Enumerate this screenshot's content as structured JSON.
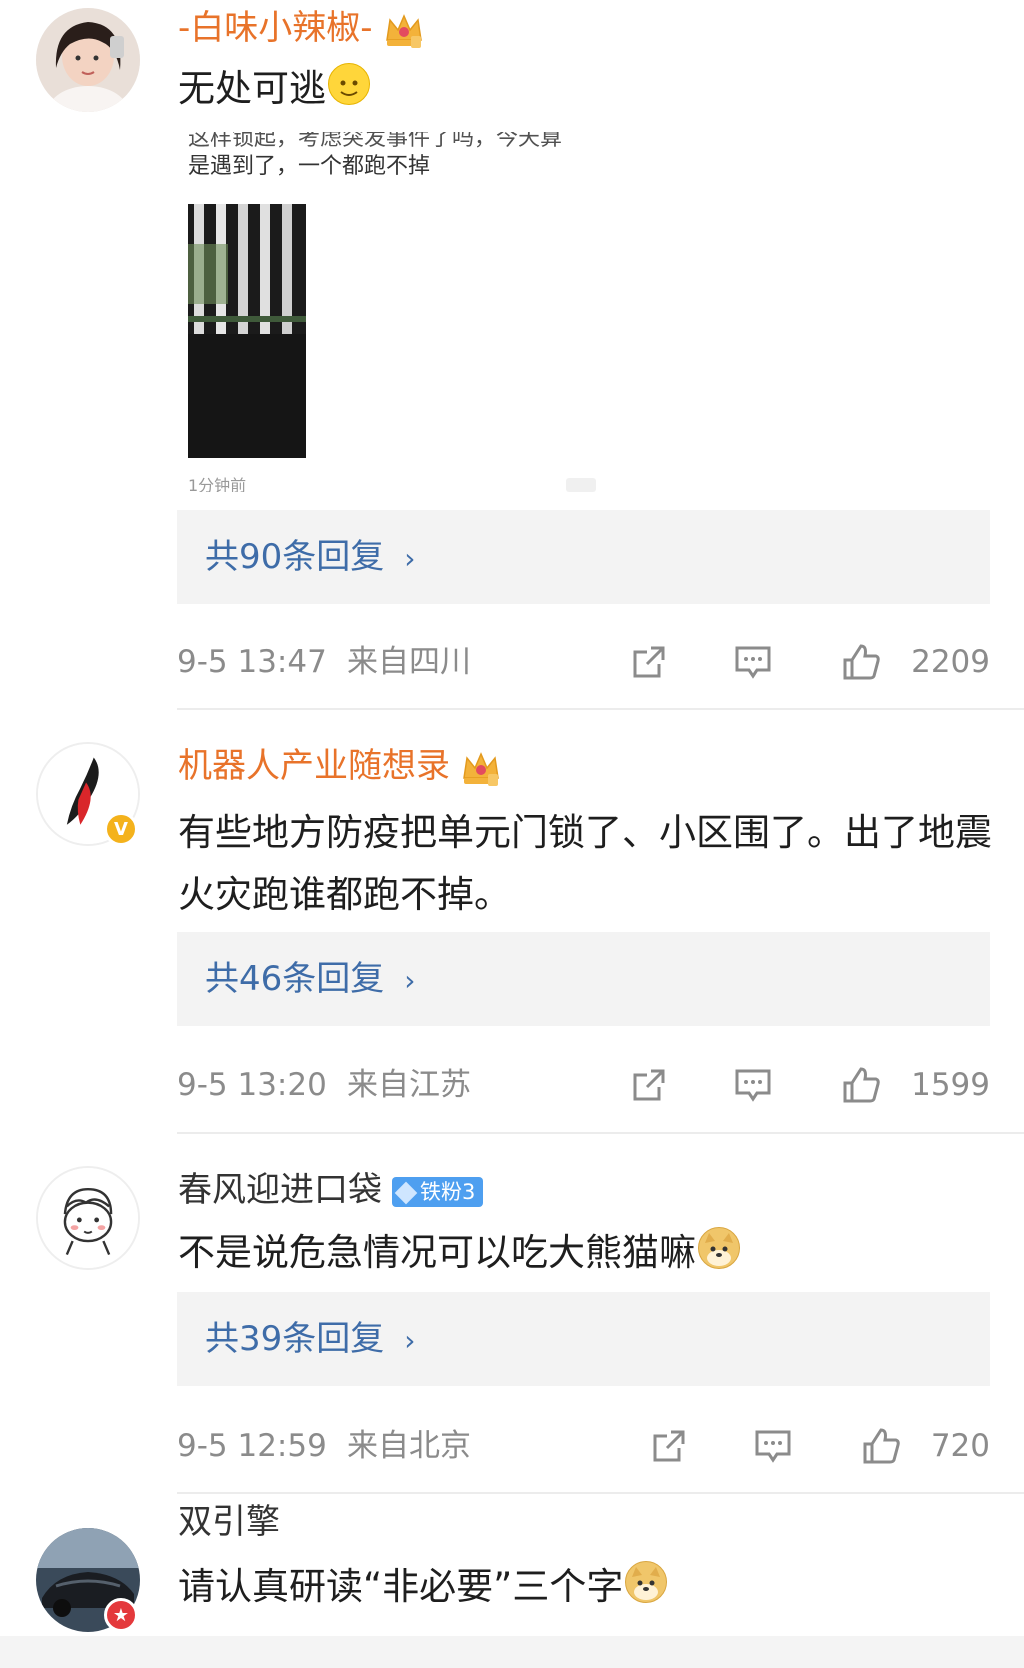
{
  "comments": [
    {
      "username": "-白味小辣椒-",
      "text": "无处可逃",
      "embedded_screenshot": {
        "partial_line": "这样锁起，考虑突发事件了吗，今天算",
        "line": "是遇到了，一个都跑不掉",
        "footer": "1分钟前"
      },
      "replies": "共90条回复",
      "time": "9-5 13:47",
      "location": "来自四川",
      "likes": "2209"
    },
    {
      "username": "机器人产业随想录",
      "text": "有些地方防疫把单元门锁了、小区围了。出了地震火灾跑谁都跑不掉。",
      "replies": "共46条回复",
      "time": "9-5 13:20",
      "location": "来自江苏",
      "likes": "1599"
    },
    {
      "username": "春风迎进口袋",
      "badge": "铁粉3",
      "text": "不是说危急情况可以吃大熊猫嘛",
      "replies": "共39条回复",
      "time": "9-5 12:59",
      "location": "来自北京",
      "likes": "720"
    },
    {
      "username": "双引擎",
      "text": "请认真研读“非必要”三个字"
    }
  ],
  "icons": {
    "share": "share-icon",
    "comment": "comment-icon",
    "like": "thumbs-up-icon",
    "crown": "vip-crown-icon",
    "verified": "verified-v-icon"
  },
  "colors": {
    "vip_name": "#e8732a",
    "reply_link": "#3e6ca8",
    "meta_gray": "#8b8b8b",
    "fan_badge": "#4e9ff0"
  }
}
